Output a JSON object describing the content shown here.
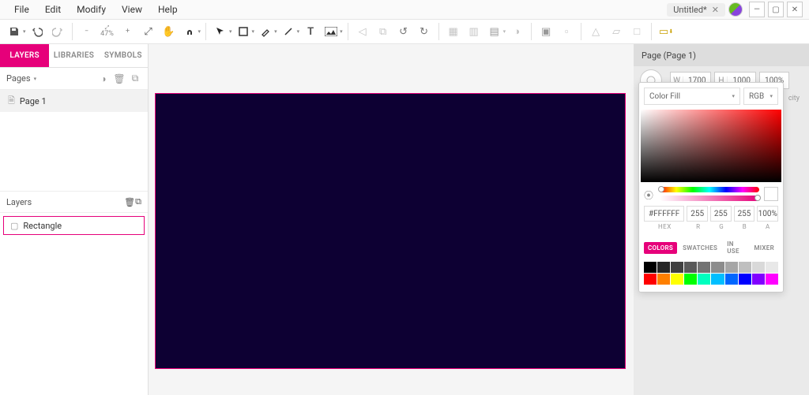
{
  "menubar": {
    "items": [
      "File",
      "Edit",
      "Modify",
      "View",
      "Help"
    ]
  },
  "document": {
    "title": "Untitled*"
  },
  "toolbar": {
    "zoom_pct": "47%"
  },
  "left": {
    "tabs": [
      "LAYERS",
      "LIBRARIES",
      "SYMBOLS"
    ],
    "active_tab": 0,
    "pages_label": "Pages",
    "pages": [
      "Page 1"
    ],
    "layers_label": "Layers",
    "layers": [
      "Rectangle"
    ]
  },
  "right": {
    "page_label": "Page (Page 1)",
    "width": "1700",
    "height": "1000",
    "opacity": "100%",
    "opacity_label": "city"
  },
  "color_picker": {
    "mode_label": "Color Fill",
    "space_label": "RGB",
    "hex": "#FFFFFF",
    "r": "255",
    "g": "255",
    "b": "255",
    "a": "100%",
    "labels": {
      "hex": "HEX",
      "r": "R",
      "g": "G",
      "b": "B",
      "a": "A"
    },
    "tabs": [
      "COLORS",
      "SWATCHES",
      "IN USE",
      "MIXER"
    ],
    "active_tab": 0,
    "swatch_rows": [
      [
        "#000000",
        "#262626",
        "#404040",
        "#595959",
        "#737373",
        "#8c8c8c",
        "#a6a6a6",
        "#bfbfbf",
        "#d9d9d9",
        "#e8e8e8"
      ],
      [
        "#ff0000",
        "#ff8000",
        "#ffff00",
        "#00ff00",
        "#00ffbf",
        "#00bfff",
        "#0066ff",
        "#0000ff",
        "#8000ff",
        "#ff00ff"
      ]
    ]
  },
  "canvas": {
    "fill": "#0d0033"
  }
}
